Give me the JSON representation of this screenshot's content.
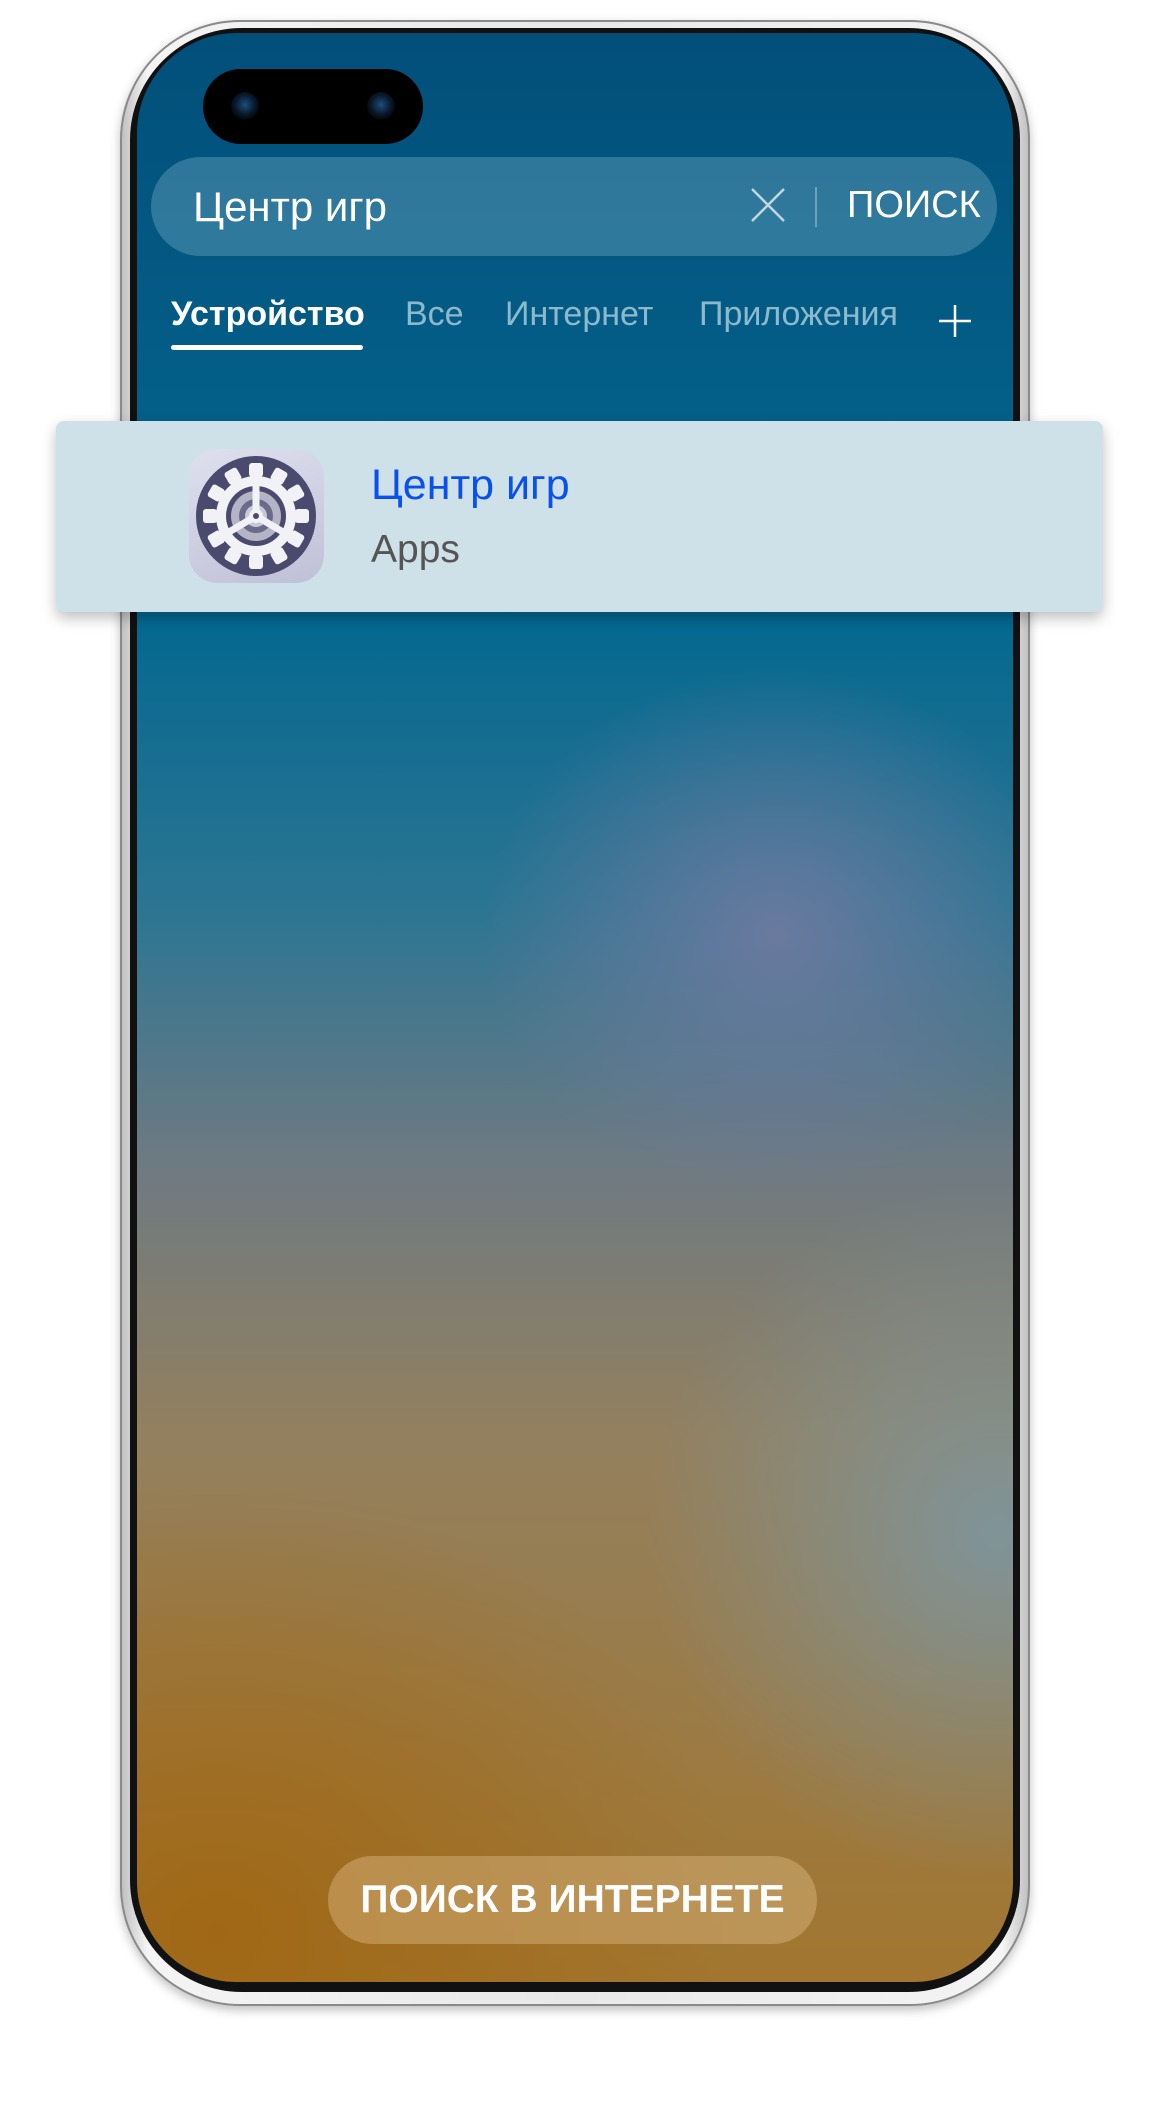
{
  "search": {
    "query": "Центр игр",
    "submit_label": "ПОИСК"
  },
  "tabs": [
    {
      "label": "Устройство",
      "active": true
    },
    {
      "label": "Все",
      "active": false
    },
    {
      "label": "Интернет",
      "active": false
    },
    {
      "label": "Приложения",
      "active": false
    }
  ],
  "result": {
    "title": "Центр игр",
    "subtitle": "Apps",
    "icon": "game-center-gear-icon"
  },
  "web_search_label": "ПОИСК В ИНТЕРНЕТЕ",
  "colors": {
    "accent": "#0a50f0",
    "card": "#cfe1e8"
  }
}
